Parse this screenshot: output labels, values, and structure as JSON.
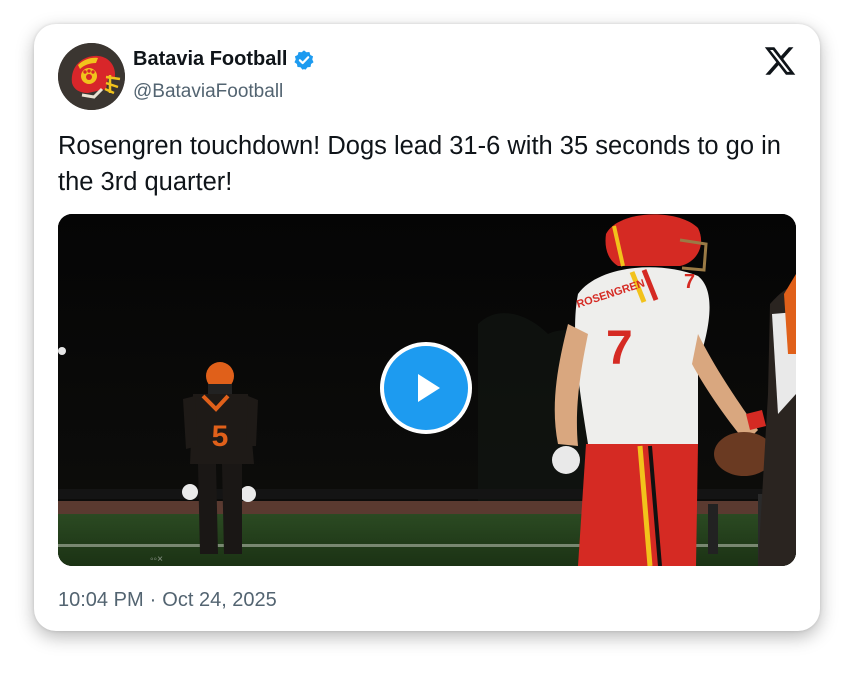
{
  "tweet": {
    "author": {
      "display_name": "Batavia Football",
      "handle": "@BataviaFootball",
      "verified": true,
      "avatar_icon": "bulldog-helmet-logo"
    },
    "text": "Rosengren touchdown! Dogs lead 31-6 with 35 seconds to go in the 3rd quarter!",
    "media": {
      "type": "video",
      "control_icon": "play-icon",
      "jersey_numbers": [
        "5",
        "7"
      ],
      "jersey_name": "ROSENGREN"
    },
    "time": "10:04 PM",
    "separator": "·",
    "date": "Oct 24, 2025"
  },
  "colors": {
    "accent_blue": "#1d9bf0",
    "text_primary": "#0f1419",
    "text_secondary": "#536471",
    "team_red": "#d82a2a",
    "team_gold": "#f2c21b"
  }
}
